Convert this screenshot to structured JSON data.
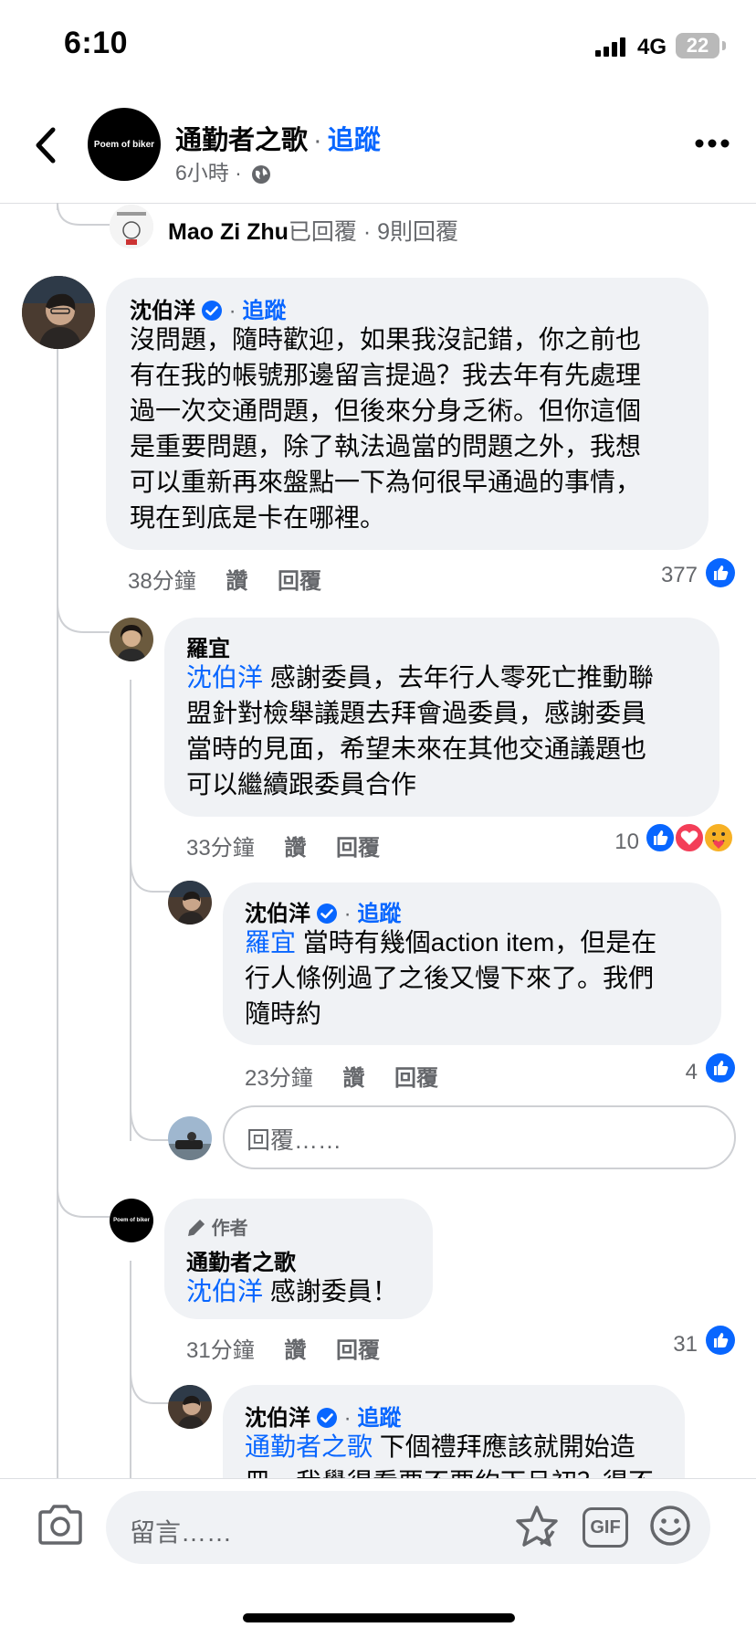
{
  "status": {
    "time": "6:10",
    "network": "4G",
    "battery": "22"
  },
  "header": {
    "page_name": "通勤者之歌",
    "follow": "追蹤",
    "meta": "6小時 ·",
    "avatar_text": "Poem of biker"
  },
  "replies_summary": {
    "name": "Mao Zi Zhu",
    "text": "已回覆 · 9則回覆"
  },
  "comments": [
    {
      "name": "沈伯洋",
      "follow": "追蹤",
      "lines": [
        "沒問題，隨時歡迎，如果我沒記錯，你之前也",
        "有在我的帳號那邊留言提過？我去年有先處理",
        "過一次交通問題，但後來分身乏術。但你這個",
        "是重要問題，除了執法過當的問題之外，我想",
        "可以重新再來盤點一下為何很早通過的事情，",
        "現在到底是卡在哪裡。"
      ],
      "time": "38分鐘",
      "like": "讚",
      "reply": "回覆",
      "count": "377"
    },
    {
      "name": "羅宜",
      "mention": "沈伯洋",
      "lines": [
        " 感謝委員，去年行人零死亡推動聯",
        "盟針對檢舉議題去拜會過委員，感謝委員",
        "當時的見面，希望未來在其他交通議題也",
        "可以繼續跟委員合作"
      ],
      "time": "33分鐘",
      "like": "讚",
      "reply": "回覆",
      "count": "10"
    },
    {
      "name": "沈伯洋",
      "follow": "追蹤",
      "mention": "羅宜",
      "lines": [
        " 當時有幾個action item，但是在",
        "行人條例過了之後又慢下來了。我們",
        "隨時約"
      ],
      "time": "23分鐘",
      "like": "讚",
      "reply": "回覆",
      "count": "4"
    },
    {
      "author_badge": "作者",
      "name": "通勤者之歌",
      "mention": "沈伯洋",
      "lines": [
        " 感謝委員！"
      ],
      "time": "31分鐘",
      "like": "讚",
      "reply": "回覆",
      "count": "31"
    },
    {
      "name": "沈伯洋",
      "follow": "追蹤",
      "mention": "通勤者之歌",
      "lines": [
        " 下個禮拜應該就開始造",
        "冊，我覺得看要不要約下旦初？得不"
      ]
    }
  ],
  "reply_input": {
    "placeholder": "回覆……"
  },
  "bottom": {
    "placeholder": "留言……",
    "gif": "GIF"
  },
  "colors": {
    "accent": "#0866ff",
    "bubble": "#f0f2f5",
    "muted": "#65676b"
  }
}
